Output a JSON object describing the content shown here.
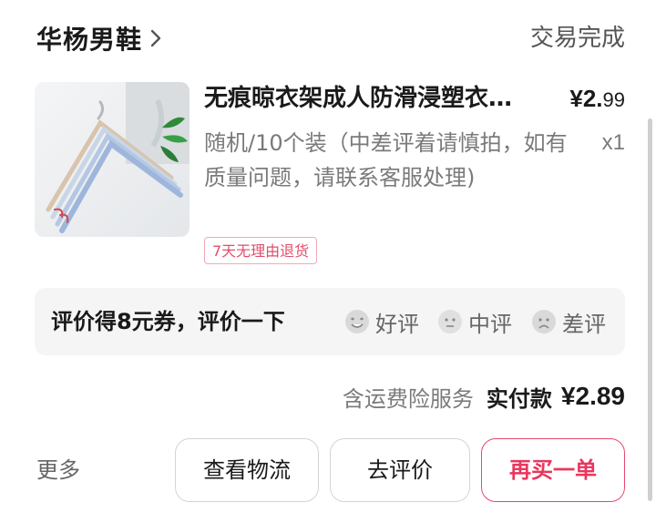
{
  "shop": {
    "name": "华杨男鞋",
    "status": "交易完成"
  },
  "product": {
    "title": "无痕晾衣架成人防滑浸塑衣…",
    "price_symbol": "¥",
    "price_int": "2.",
    "price_dec": "99",
    "spec": "随机/10个装（中差评着请慎拍，如有质量问题，请联系客服处理)",
    "quantity": "x1",
    "return_tag": "7天无理由退货",
    "image_icon": "clothes-hanger-product-image"
  },
  "review": {
    "prompt": "评价得8元券，评价一下",
    "good": "好评",
    "mid": "中评",
    "bad": "差评"
  },
  "payment": {
    "note": "含运费险服务",
    "label": "实付款",
    "amount": "¥2.89"
  },
  "actions": {
    "more": "更多",
    "logistics": "查看物流",
    "review": "去评价",
    "rebuy": "再买一单"
  },
  "colors": {
    "accent": "#e8375e",
    "tag_border": "#f3a7b8",
    "muted": "#7a7a7a"
  }
}
